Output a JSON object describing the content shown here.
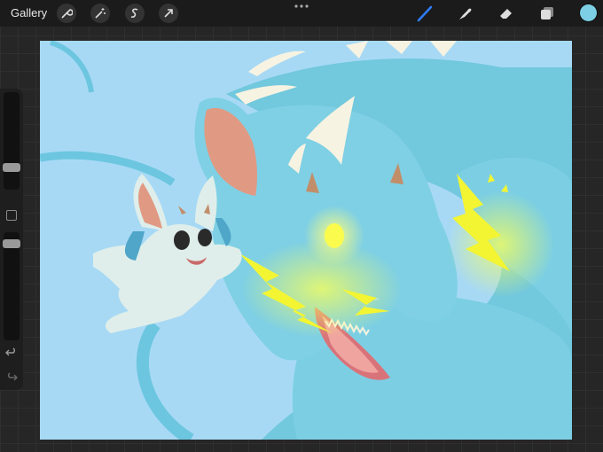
{
  "topbar": {
    "gallery_label": "Gallery",
    "left_tools": [
      "wrench-icon",
      "magic-wand-icon",
      "selection-icon",
      "transform-arrow-icon"
    ],
    "right_tools": [
      "brush-icon",
      "smudge-icon",
      "eraser-icon",
      "layers-icon"
    ],
    "active_tool": "brush-icon",
    "active_color": "#7ccfe4"
  },
  "sidebar": {
    "size_slider_level": 0.55,
    "opacity_slider_level": 0.08,
    "undo_icon": "undo-icon",
    "redo_icon": "redo-icon"
  },
  "canvas": {
    "background": "#a7d9f5",
    "subject": "artwork"
  }
}
